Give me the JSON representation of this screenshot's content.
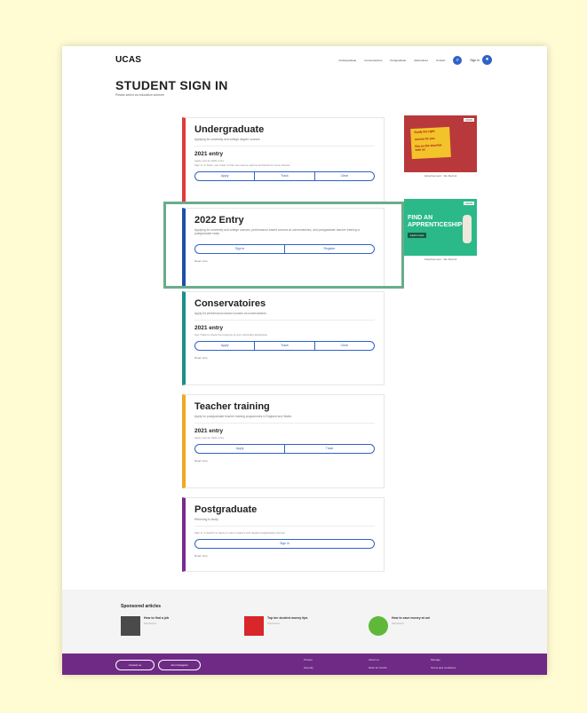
{
  "header": {
    "logo": "UCAS",
    "nav": [
      "Undergraduate",
      "Conservatoires",
      "Postgraduate",
      "Alternatives",
      "Contact"
    ],
    "sign_in": "Sign in",
    "search_icon": "search-icon",
    "avatar_icon": "user-icon"
  },
  "page": {
    "title": "STUDENT SIGN IN",
    "subtitle": "Please select an education scheme"
  },
  "cards": [
    {
      "title": "Undergraduate",
      "description": "Applying for university and college degree courses",
      "entry": "2021 entry",
      "note": "Apply now for 2021 entry",
      "note2": "Sign in to Track, use Clear to find new course options and Extra for more choices",
      "buttons": [
        "Apply",
        "Track",
        "Clear"
      ],
      "accent": "#e03a3a"
    },
    {
      "title": "2022 Entry",
      "description": "Applying for university and college courses, performance-based courses at conservatoires, and postgraduate teacher training or postgraduate study",
      "buttons": [
        "Sign in",
        "Register"
      ],
      "read_more": "Read more",
      "accent": "#1f4fa8"
    },
    {
      "title": "Conservatoires",
      "description": "Apply for performance-based courses at conservatoires",
      "entry": "2021 entry",
      "note": "Use Track to check the progress of your submitted application",
      "buttons": [
        "Apply",
        "Track",
        "Clear"
      ],
      "read_more": "Read more",
      "accent": "#1a8f88"
    },
    {
      "title": "Teacher training",
      "description": "Apply for postgraduate teacher training programmes in England and Wales",
      "entry": "2021 entry",
      "note": "Apply now for 2021 entry",
      "buttons": [
        "Apply",
        "Track"
      ],
      "read_more": "Read more",
      "accent": "#f0a81e"
    },
    {
      "title": "Postgraduate",
      "description": "Returning to study",
      "note": "Sign in to Search to apply to some masters and taught postgraduate courses",
      "buttons": [
        "Sign in"
      ],
      "read_more": "Read more",
      "accent": "#7b2b8f"
    }
  ],
  "ads": [
    {
      "tag": "UCAS",
      "lines": [
        "Study the right",
        "course for you",
        "Get on the shortlist with us"
      ],
      "caption": "Advertisement - We Recruit"
    },
    {
      "tag": "UCAS",
      "headline": "FIND AN APPRENTICESHIP",
      "cta": "Learn more",
      "caption": "Advertisement - We Recruit"
    }
  ],
  "sponsored": {
    "heading": "Sponsored articles",
    "articles": [
      {
        "title": "How to find a job",
        "sub": "Sponsored"
      },
      {
        "title": "Top ten student money tips",
        "sub": "Sponsored"
      },
      {
        "title": "How to save money at uni",
        "sub": "Sponsored"
      }
    ]
  },
  "footer": {
    "buttons": [
      "Contact us",
      "Join Instagram"
    ],
    "links": [
      "Privacy",
      "Security",
      "About us",
      "Work for UCAS",
      "Manage",
      "Terms and conditions"
    ]
  },
  "colors": {
    "accent_blue": "#2f62c7",
    "highlight": "#6aac8a",
    "footer": "#6e2a84"
  }
}
